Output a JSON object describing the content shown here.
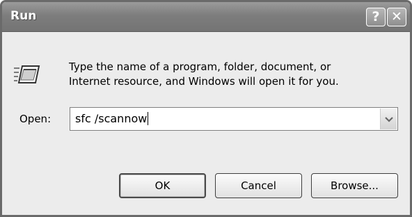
{
  "window": {
    "title": "Run",
    "help_glyph": "?",
    "close_glyph": "✕"
  },
  "dialog": {
    "description": "Type the name of a program, folder, document, or\nInternet resource, and Windows will open it for you.",
    "icon": "run-icon",
    "open_label": "Open:",
    "open_value": "sfc /scannow"
  },
  "buttons": {
    "ok": "OK",
    "cancel": "Cancel",
    "browse": "Browse..."
  }
}
